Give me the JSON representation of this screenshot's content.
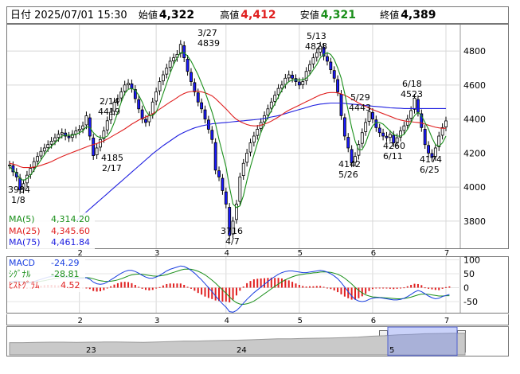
{
  "header": {
    "datetime": "日付 2025/07/01 15:30",
    "open_label": "始値",
    "open": "4,322",
    "high_label": "高値",
    "high": "4,412",
    "low_label": "安値",
    "low": "4,321",
    "close_label": "終値",
    "close": "4,389"
  },
  "colors": {
    "up": "#ffffff",
    "down": "#1a1aff",
    "ma5": "#1a8f1a",
    "ma25": "#e02020",
    "ma75": "#2020e0",
    "macd": "#1a3fe0",
    "signal": "#1a8f1a",
    "hist": "#e02020"
  },
  "legend": {
    "ma5_label": "MA(5)",
    "ma5": "4,314.20",
    "ma25_label": "MA(25)",
    "ma25": "4,345.60",
    "ma75_label": "MA(75)",
    "ma75": "4,461.84"
  },
  "macd_legend": {
    "macd_label": "MACD",
    "macd": "-24.29",
    "signal_label": "ｼｸﾞﾅﾙ",
    "signal": "-28.81",
    "hist_label": "ﾋｽﾄｸﾞﾗﾑ",
    "hist": "4.52"
  },
  "annotations": [
    {
      "text": "3/27",
      "text2": "4839"
    },
    {
      "text": "5/13",
      "text2": "4828"
    },
    {
      "text": "2/14",
      "text2": "4419"
    },
    {
      "text": "6/18",
      "text2": "4523"
    },
    {
      "text": "5/29",
      "text2": "4443"
    },
    {
      "text": "4185",
      "text2": "2/17"
    },
    {
      "text": "4260",
      "text2": "6/11"
    },
    {
      "text": "4142",
      "text2": "5/26"
    },
    {
      "text": "4174",
      "text2": "6/25"
    },
    {
      "text": "3984",
      "text2": "1/8"
    },
    {
      "text": "3716",
      "text2": "4/7"
    }
  ],
  "navigator": {
    "labels": [
      "23",
      "24",
      "5"
    ]
  },
  "chart_data": [
    {
      "type": "candlestick",
      "x_ticks": [
        "2",
        "3",
        "4",
        "5",
        "6",
        "7"
      ],
      "y_ticks": [
        3800,
        4000,
        4200,
        4400,
        4600,
        4800
      ],
      "ylim": [
        3650,
        4950
      ],
      "series_close": [
        4130,
        4090,
        4060,
        3984,
        4020,
        4070,
        4110,
        4150,
        4180,
        4210,
        4230,
        4250,
        4270,
        4290,
        4310,
        4320,
        4300,
        4290,
        4310,
        4330,
        4340,
        4360,
        4419,
        4300,
        4185,
        4230,
        4280,
        4330,
        4390,
        4440,
        4500,
        4520,
        4560,
        4600,
        4610,
        4580,
        4520,
        4460,
        4400,
        4380,
        4420,
        4500,
        4560,
        4620,
        4660,
        4700,
        4740,
        4760,
        4780,
        4839,
        4760,
        4680,
        4620,
        4560,
        4500,
        4460,
        4400,
        4340,
        4280,
        4100,
        4060,
        3980,
        3900,
        3716,
        3800,
        3900,
        4060,
        4140,
        4200,
        4260,
        4300,
        4340,
        4380,
        4420,
        4460,
        4500,
        4540,
        4580,
        4600,
        4640,
        4660,
        4640,
        4620,
        4600,
        4620,
        4680,
        4720,
        4760,
        4790,
        4828,
        4770,
        4740,
        4690,
        4640,
        4560,
        4420,
        4300,
        4230,
        4142,
        4180,
        4250,
        4320,
        4380,
        4443,
        4400,
        4350,
        4320,
        4300,
        4290,
        4310,
        4260,
        4290,
        4330,
        4360,
        4400,
        4450,
        4523,
        4440,
        4350,
        4250,
        4200,
        4174,
        4230,
        4300,
        4350,
        4389
      ],
      "ma5": [
        4120,
        4100,
        4080,
        4050,
        4040,
        4050,
        4070,
        4100,
        4130,
        4160,
        4190,
        4220,
        4240,
        4260,
        4280,
        4300,
        4305,
        4305,
        4305,
        4310,
        4320,
        4330,
        4355,
        4350,
        4320,
        4300,
        4290,
        4290,
        4300,
        4330,
        4380,
        4440,
        4500,
        4550,
        4575,
        4580,
        4570,
        4540,
        4500,
        4450,
        4420,
        4420,
        4440,
        4490,
        4550,
        4610,
        4670,
        4720,
        4760,
        4790,
        4790,
        4770,
        4740,
        4700,
        4660,
        4610,
        4560,
        4500,
        4440,
        4370,
        4280,
        4200,
        4120,
        4000,
        3900,
        3880,
        3890,
        3950,
        4040,
        4120,
        4190,
        4260,
        4320,
        4370,
        4410,
        4450,
        4490,
        4530,
        4570,
        4600,
        4620,
        4630,
        4630,
        4630,
        4630,
        4640,
        4660,
        4690,
        4720,
        4760,
        4780,
        4790,
        4780,
        4750,
        4700,
        4640,
        4550,
        4450,
        4350,
        4270,
        4220,
        4220,
        4260,
        4320,
        4360,
        4380,
        4380,
        4370,
        4350,
        4330,
        4310,
        4300,
        4300,
        4310,
        4340,
        4380,
        4420,
        4440,
        4420,
        4380,
        4340,
        4290,
        4250,
        4240,
        4260,
        4300
      ],
      "ma25": [
        4140,
        4135,
        4130,
        4120,
        4115,
        4115,
        4115,
        4118,
        4122,
        4128,
        4135,
        4142,
        4150,
        4160,
        4170,
        4180,
        4188,
        4196,
        4204,
        4212,
        4220,
        4228,
        4236,
        4244,
        4250,
        4256,
        4264,
        4272,
        4282,
        4294,
        4306,
        4318,
        4330,
        4342,
        4356,
        4370,
        4382,
        4394,
        4404,
        4412,
        4420,
        4432,
        4444,
        4458,
        4472,
        4486,
        4500,
        4512,
        4526,
        4540,
        4550,
        4558,
        4562,
        4564,
        4564,
        4560,
        4554,
        4546,
        4536,
        4520,
        4500,
        4480,
        4460,
        4438,
        4416,
        4398,
        4386,
        4376,
        4368,
        4362,
        4360,
        4360,
        4364,
        4370,
        4378,
        4388,
        4400,
        4412,
        4426,
        4440,
        4452,
        4462,
        4472,
        4482,
        4492,
        4502,
        4512,
        4522,
        4532,
        4542,
        4548,
        4554,
        4556,
        4556,
        4554,
        4548,
        4540,
        4530,
        4518,
        4506,
        4494,
        4484,
        4474,
        4464,
        4456,
        4448,
        4440,
        4432,
        4424,
        4416,
        4408,
        4400,
        4394,
        4390,
        4386,
        4384,
        4382,
        4380,
        4376,
        4370,
        4364,
        4358,
        4352,
        4348,
        4346,
        4345.6
      ],
      "ma75": [
        null,
        null,
        null,
        null,
        null,
        null,
        null,
        null,
        null,
        null,
        null,
        null,
        null,
        null,
        null,
        null,
        null,
        null,
        null,
        3800,
        3818,
        3836,
        3854,
        3872,
        3890,
        3908,
        3926,
        3944,
        3962,
        3980,
        3998,
        4016,
        4034,
        4052,
        4070,
        4088,
        4106,
        4124,
        4142,
        4160,
        4178,
        4196,
        4212,
        4228,
        4244,
        4258,
        4272,
        4286,
        4300,
        4312,
        4322,
        4332,
        4340,
        4348,
        4354,
        4360,
        4364,
        4368,
        4372,
        4374,
        4376,
        4378,
        4380,
        4382,
        4384,
        4386,
        4388,
        4390,
        4392,
        4394,
        4396,
        4398,
        4400,
        4404,
        4408,
        4412,
        4416,
        4420,
        4426,
        4432,
        4438,
        4444,
        4450,
        4456,
        4462,
        4468,
        4474,
        4480,
        4484,
        4488,
        4490,
        4492,
        4494,
        4494,
        4494,
        4494,
        4492,
        4490,
        4488,
        4486,
        4484,
        4482,
        4480,
        4478,
        4476,
        4474,
        4472,
        4470,
        4468,
        4466,
        4465,
        4464,
        4463,
        4462,
        4462,
        4462,
        4462,
        4462,
        4462,
        4462,
        4462,
        4462,
        4462,
        4461.84,
        4461.84,
        4461.84
      ],
      "macd_ylim": [
        -90,
        110
      ],
      "macd_ticks": [
        100,
        50,
        0,
        -50
      ],
      "macd": [
        20,
        22,
        24,
        22,
        18,
        16,
        18,
        22,
        26,
        30,
        34,
        38,
        40,
        42,
        43,
        42,
        40,
        38,
        36,
        34,
        33,
        33,
        36,
        30,
        20,
        14,
        12,
        14,
        20,
        28,
        36,
        44,
        52,
        58,
        62,
        62,
        58,
        52,
        44,
        38,
        34,
        34,
        38,
        44,
        52,
        60,
        66,
        70,
        74,
        78,
        76,
        70,
        62,
        52,
        40,
        28,
        14,
        0,
        -14,
        -30,
        -44,
        -58,
        -70,
        -86,
        -88,
        -82,
        -70,
        -56,
        -42,
        -30,
        -18,
        -8,
        2,
        12,
        22,
        32,
        40,
        48,
        54,
        58,
        60,
        60,
        58,
        56,
        54,
        54,
        56,
        58,
        60,
        62,
        60,
        56,
        50,
        42,
        32,
        18,
        2,
        -14,
        -30,
        -42,
        -48,
        -50,
        -48,
        -42,
        -38,
        -36,
        -36,
        -38,
        -40,
        -42,
        -44,
        -44,
        -42,
        -38,
        -32,
        -24,
        -16,
        -10,
        -14,
        -22,
        -30,
        -36,
        -40,
        -38,
        -32,
        -28,
        -24.29
      ],
      "signal": [
        18,
        19,
        20,
        21,
        21,
        20,
        20,
        20,
        21,
        23,
        25,
        28,
        30,
        33,
        35,
        37,
        38,
        38,
        38,
        37,
        36,
        36,
        36,
        35,
        32,
        28,
        25,
        23,
        22,
        23,
        25,
        28,
        32,
        37,
        42,
        46,
        48,
        49,
        48,
        46,
        44,
        42,
        41,
        42,
        44,
        47,
        51,
        55,
        59,
        63,
        66,
        67,
        66,
        63,
        59,
        53,
        46,
        37,
        27,
        16,
        4,
        -8,
        -20,
        -33,
        -45,
        -54,
        -59,
        -60,
        -58,
        -54,
        -48,
        -40,
        -31,
        -22,
        -13,
        -4,
        5,
        13,
        21,
        28,
        34,
        39,
        43,
        46,
        48,
        50,
        51,
        53,
        54,
        56,
        57,
        56,
        55,
        52,
        48,
        42,
        34,
        24,
        13,
        1,
        -10,
        -19,
        -26,
        -30,
        -33,
        -34,
        -35,
        -36,
        -37,
        -38,
        -39,
        -40,
        -40,
        -39,
        -37,
        -34,
        -30,
        -26,
        -23,
        -23,
        -24,
        -26,
        -28,
        -30,
        -30,
        -29,
        -28.81
      ],
      "hist": [
        2,
        3,
        4,
        1,
        -3,
        -4,
        -2,
        2,
        5,
        7,
        9,
        10,
        10,
        9,
        8,
        5,
        2,
        0,
        -2,
        -3,
        -3,
        -3,
        0,
        -5,
        -12,
        -14,
        -13,
        -9,
        -2,
        5,
        11,
        16,
        20,
        21,
        20,
        16,
        10,
        3,
        -4,
        -8,
        -10,
        -8,
        -3,
        2,
        8,
        13,
        15,
        15,
        15,
        15,
        10,
        3,
        -4,
        -11,
        -19,
        -25,
        -32,
        -37,
        -41,
        -46,
        -48,
        -50,
        -50,
        -53,
        -43,
        -28,
        -11,
        4,
        16,
        24,
        30,
        32,
        33,
        34,
        35,
        36,
        35,
        35,
        33,
        30,
        26,
        21,
        15,
        10,
        6,
        4,
        5,
        5,
        6,
        6,
        3,
        0,
        -5,
        -10,
        -16,
        -24,
        -32,
        -38,
        -43,
        -43,
        -38,
        -31,
        -22,
        -12,
        -5,
        -2,
        -1,
        -2,
        -3,
        -4,
        -5,
        -4,
        -2,
        1,
        5,
        10,
        14,
        13,
        9,
        1,
        -4,
        -6,
        -8,
        -9,
        -4,
        2,
        4.52
      ]
    }
  ]
}
